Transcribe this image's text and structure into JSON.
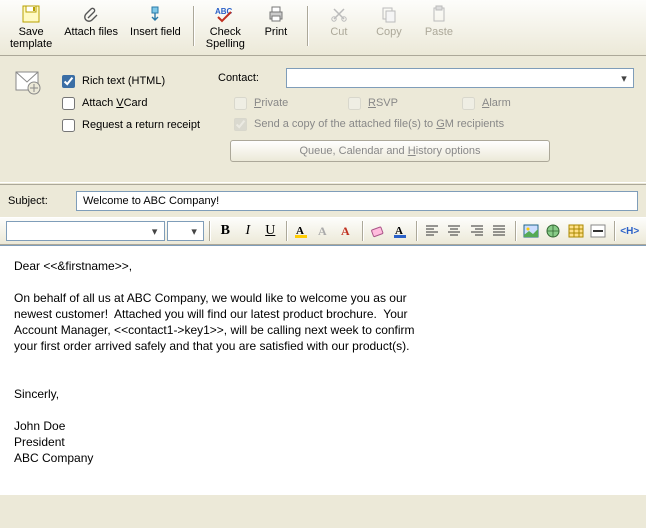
{
  "toolbar": {
    "save_template": "Save\ntemplate",
    "attach_files": "Attach files",
    "insert_field": "Insert field",
    "check_spelling": "Check\nSpelling",
    "print": "Print",
    "cut": "Cut",
    "copy": "Copy",
    "paste": "Paste"
  },
  "options": {
    "rich_text": "Rich text (HTML)",
    "attach_vcard_pre": "Attach ",
    "attach_vcard_u": "V",
    "attach_vcard_post": "Card",
    "return_receipt_pre": "Re",
    "return_receipt_u": "q",
    "return_receipt_post": "uest a return receipt",
    "contact_label": "Contact:",
    "private_u": "P",
    "private_post": "rivate",
    "rsvp_u": "R",
    "rsvp_post": "SVP",
    "alarm_u": "A",
    "alarm_post": "larm",
    "send_copy_pre": "Send a copy of the attached file(s) to ",
    "send_copy_u": "G",
    "send_copy_post": "M recipients",
    "queue_pre": "Queue, Calendar and ",
    "queue_u": "H",
    "queue_post": "istory options"
  },
  "subject": {
    "label": "Subject:",
    "value": "Welcome to ABC Company!"
  },
  "body": {
    "text": "Dear <<&firstname>>,\n\nOn behalf of all us at ABC Company, we would like to welcome you as our\nnewest customer!  Attached you will find our latest product brochure.  Your\nAccount Manager, <<contact1->key1>>, will be calling next week to confirm\nyour first order arrived safely and that you are satisfied with our product(s).\n\n\nSincerly,\n\nJohn Doe\nPresident\nABC Company"
  },
  "check_state": {
    "rich_text": true,
    "attach_vcard": false,
    "return_receipt": false,
    "private": false,
    "rsvp": false,
    "alarm": false,
    "send_copy": true
  }
}
